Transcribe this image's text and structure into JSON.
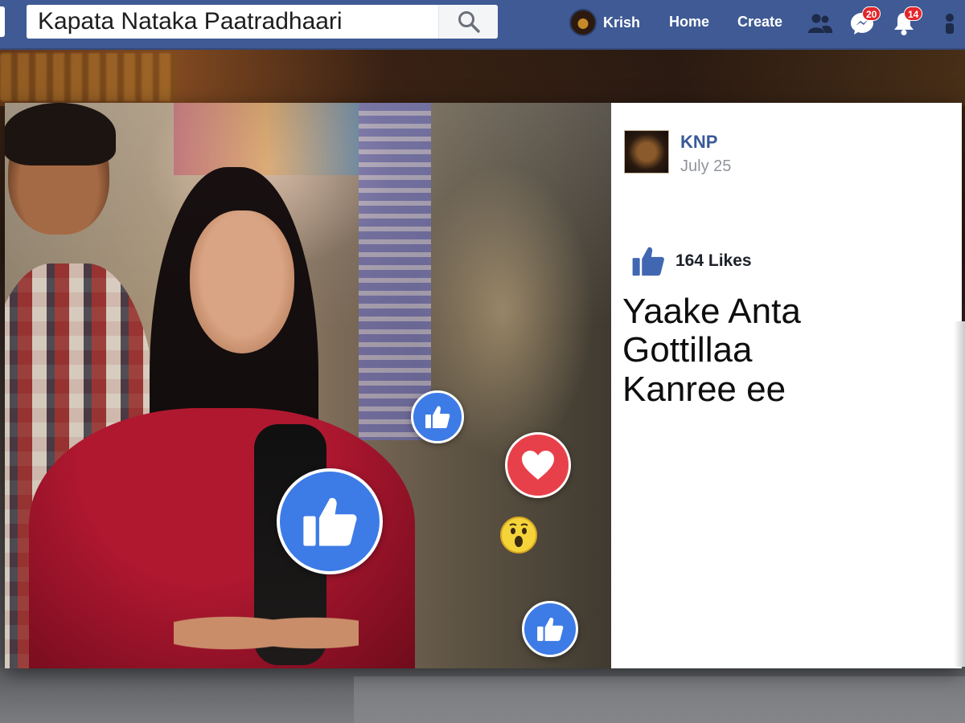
{
  "topbar": {
    "search": {
      "value": "Kapata Nataka Paatradhaari",
      "icon": "search-icon"
    },
    "user": {
      "name": "Krish",
      "avatar": "avatar"
    },
    "nav": {
      "home_label": "Home",
      "create_label": "Create"
    },
    "icons": {
      "friends": {
        "icon": "friends-icon"
      },
      "messages": {
        "icon": "messenger-icon",
        "badge": "20"
      },
      "notifications": {
        "icon": "bell-icon",
        "badge": "14"
      }
    },
    "colors": {
      "bar": "#3f5a94",
      "badge": "#e3262b"
    }
  },
  "post": {
    "page_name": "KNP",
    "date": "July 25",
    "likes_label": "164 Likes",
    "text_lines": [
      "Yaake Anta",
      "Gottillaa",
      "Kanree ee"
    ],
    "reactions": [
      "like-icon",
      "heart-icon",
      "wow-icon",
      "like-icon",
      "like-icon"
    ],
    "colors": {
      "page_name": "#3b5998",
      "like_blue": "#3d7be6",
      "heart_red": "#e8404a"
    }
  }
}
